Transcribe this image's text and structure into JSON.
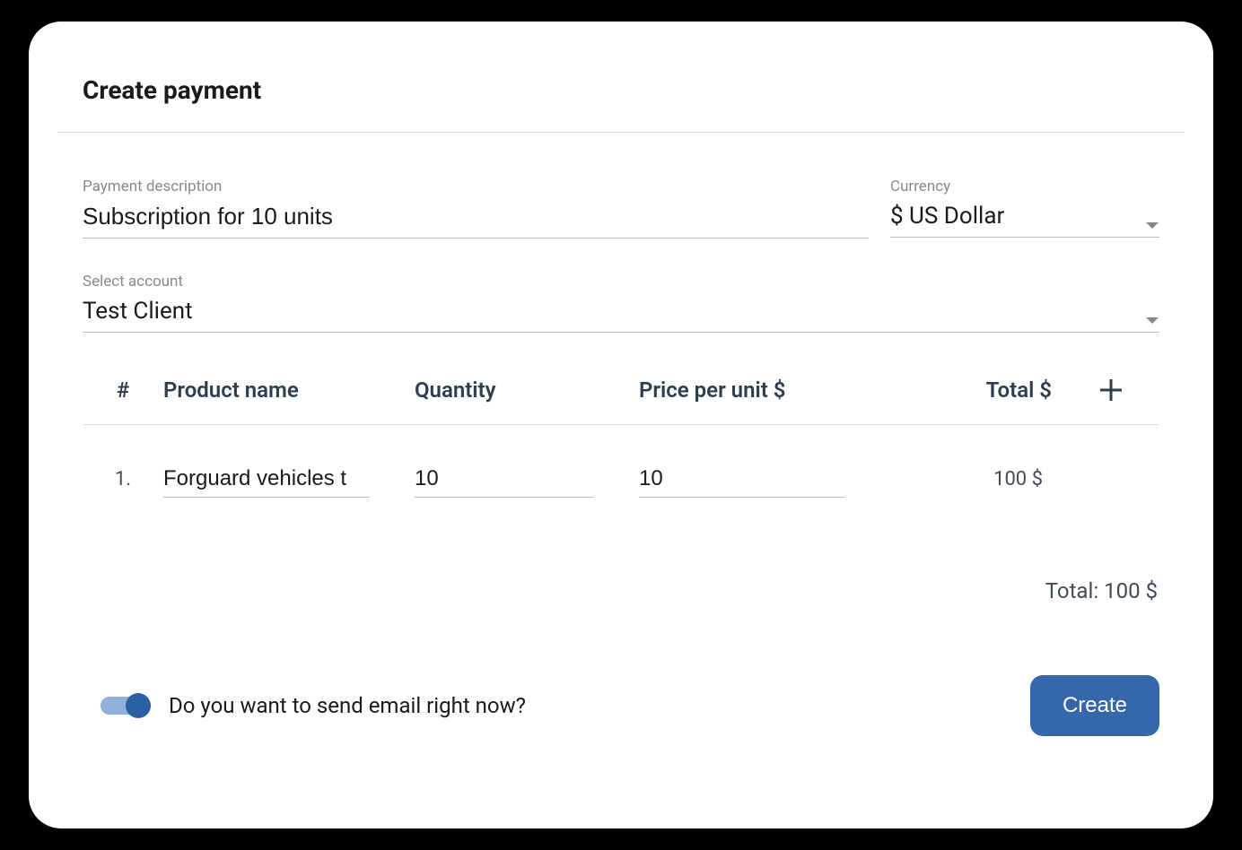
{
  "title": "Create payment",
  "fields": {
    "description": {
      "label": "Payment description",
      "value": "Subscription for 10 units"
    },
    "currency": {
      "label": "Currency",
      "value": "$ US Dollar"
    },
    "account": {
      "label": "Select account",
      "value": "Test Client"
    }
  },
  "table": {
    "headers": {
      "num": "#",
      "product": "Product name",
      "quantity": "Quantity",
      "price": "Price per unit $",
      "total": "Total $"
    },
    "rows": [
      {
        "num": "1.",
        "product": "Forguard vehicles t",
        "quantity": "10",
        "price": "10",
        "total": "100 $"
      }
    ]
  },
  "grand_total": "Total: 100 $",
  "email_toggle": {
    "label": "Do you want to send email right now?",
    "on": true
  },
  "create_button": "Create"
}
